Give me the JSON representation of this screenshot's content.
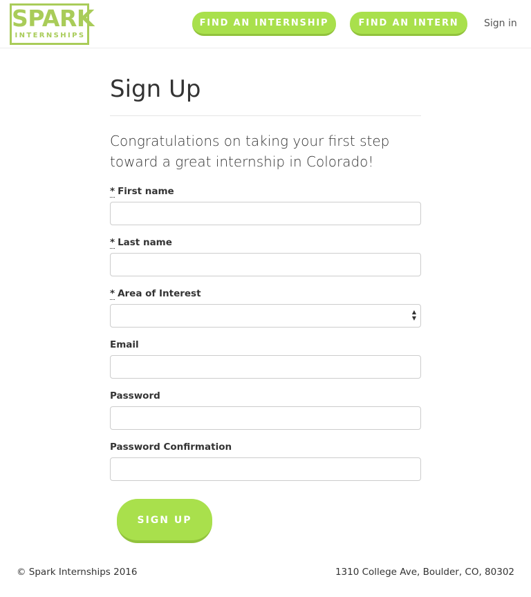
{
  "header": {
    "logo_top": "SPARK",
    "logo_bottom": "INTERNSHIPS",
    "find_internship_label": "FIND AN INTERNSHIP",
    "find_intern_label": "FIND AN INTERN",
    "signin_label": "Sign in"
  },
  "main": {
    "title": "Sign Up",
    "intro": "Congratulations on taking your first step toward a great internship in Colorado!",
    "required_mark": "*",
    "fields": [
      {
        "label": "First name",
        "value": "",
        "required": true
      },
      {
        "label": "Last name",
        "value": "",
        "required": true
      },
      {
        "label": "Area of Interest",
        "value": "",
        "required": true,
        "type": "select"
      },
      {
        "label": "Email",
        "value": "",
        "required": false
      },
      {
        "label": "Password",
        "value": "",
        "required": false
      },
      {
        "label": "Password Confirmation",
        "value": "",
        "required": false
      }
    ],
    "submit_label": "SIGN UP"
  },
  "footer": {
    "copyright": "© Spark Internships 2016",
    "address": "1310 College Ave, Boulder, CO, 80302"
  },
  "colors": {
    "accent": "#a9e04c",
    "accent_dark": "#91c23c",
    "logo": "#a9cc59"
  },
  "icons": {
    "select_arrows": "select-arrows-icon"
  }
}
